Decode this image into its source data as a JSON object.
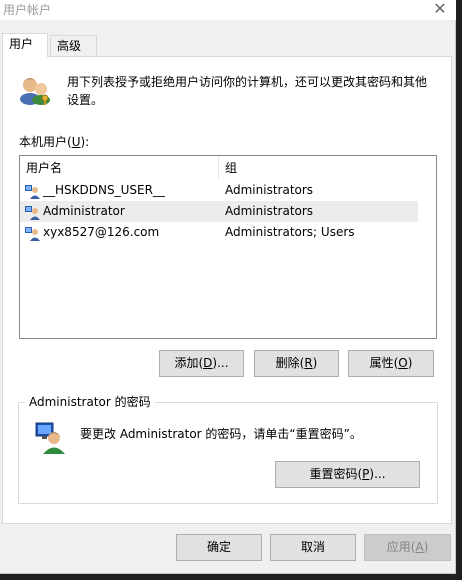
{
  "window": {
    "title": "用户帐户"
  },
  "tabs": [
    {
      "label": "用户",
      "active": true
    },
    {
      "label": "高级",
      "active": false
    }
  ],
  "description": "用下列表授予或拒绝用户访问你的计算机，还可以更改其密码和其他设置。",
  "users_label": {
    "prefix": "本机用户(",
    "key": "U",
    "suffix": "):"
  },
  "list": {
    "columns": [
      "用户名",
      "组"
    ],
    "rows": [
      {
        "name": "__HSKDDNS_USER__",
        "group": "Administrators",
        "icon": "user-icon",
        "selected": false
      },
      {
        "name": "Administrator",
        "group": "Administrators",
        "icon": "user-icon",
        "selected": true
      },
      {
        "name": "xyx8527@126.com",
        "group": "Administrators; Users",
        "icon": "user-icon",
        "selected": false
      }
    ]
  },
  "buttons": {
    "add": {
      "prefix": "添加(",
      "key": "D",
      "suffix": ")..."
    },
    "remove": {
      "prefix": "删除(",
      "key": "R",
      "suffix": ")"
    },
    "properties": {
      "prefix": "属性(",
      "key": "O",
      "suffix": ")"
    },
    "reset_password": {
      "prefix": "重置密码(",
      "key": "P",
      "suffix": ")..."
    },
    "ok": "确定",
    "cancel": "取消",
    "apply": {
      "prefix": "应用(",
      "key": "A",
      "suffix": ")"
    }
  },
  "password_group": {
    "title": "Administrator 的密码",
    "message": "要更改 Administrator 的密码，请单击“重置密码”。"
  },
  "colors": {
    "selection": "#ececec",
    "button_face": "#e1e1e1",
    "disabled_text": "#838383"
  }
}
